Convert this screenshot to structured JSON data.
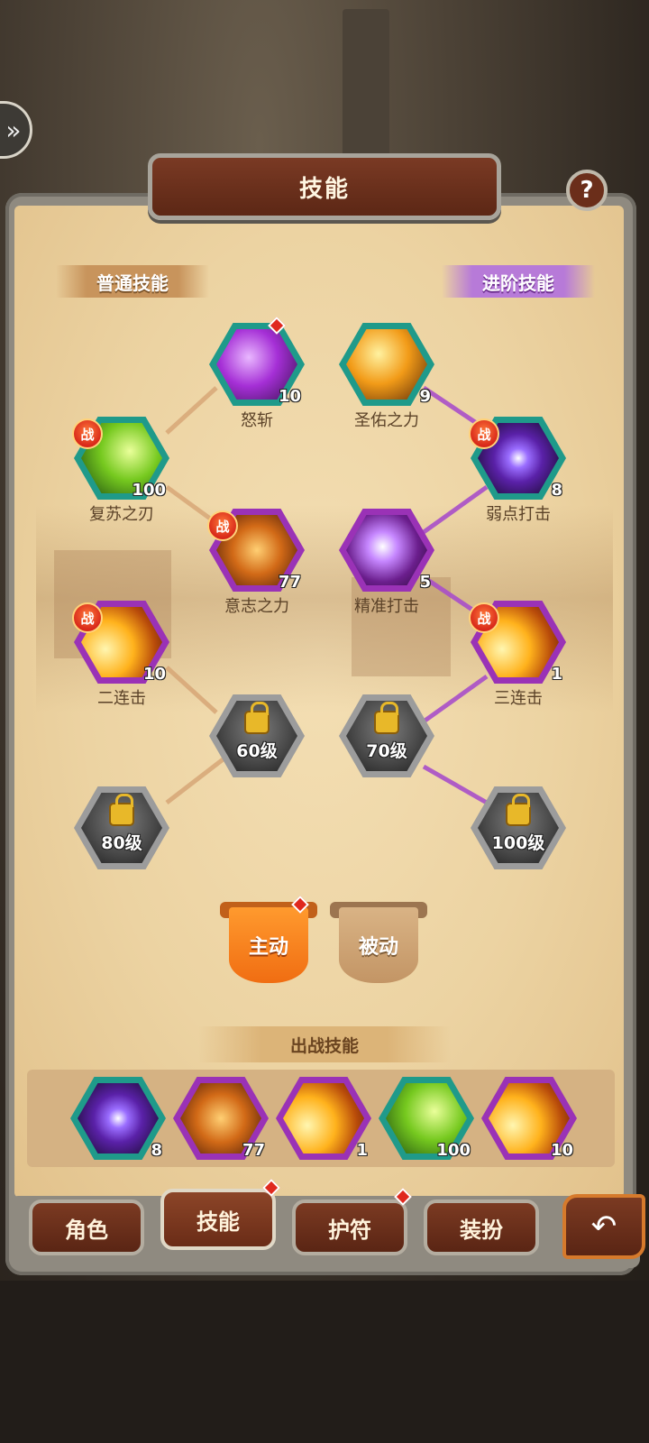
{
  "header": {
    "title": "技能",
    "help_icon": "help-icon",
    "help_label": "?"
  },
  "sections": {
    "normal": "普通技能",
    "advanced": "进阶技能"
  },
  "skill_nodes": [
    {
      "name": "怒斩",
      "level": "10",
      "art": "art-purple",
      "border": "teal"
    },
    {
      "name": "圣佑之力",
      "level": "9",
      "art": "art-gold",
      "border": "teal"
    },
    {
      "name": "复苏之刃",
      "level": "100",
      "art": "art-green",
      "border": "teal",
      "badge": "战"
    },
    {
      "name": "弱点打击",
      "level": "8",
      "art": "art-eye",
      "border": "teal",
      "badge": "战"
    },
    {
      "name": "意志之力",
      "level": "77",
      "art": "art-fist",
      "border": "purple",
      "badge": "战"
    },
    {
      "name": "精准打击",
      "level": "5",
      "art": "art-shadow",
      "border": "purple"
    },
    {
      "name": "二连击",
      "level": "10",
      "art": "art-burst",
      "border": "purple",
      "badge": "战"
    },
    {
      "name": "三连击",
      "level": "1",
      "art": "art-burst",
      "border": "purple",
      "badge": "战"
    }
  ],
  "locked_nodes": [
    {
      "level": "60级"
    },
    {
      "level": "70级"
    },
    {
      "level": "80级"
    },
    {
      "level": "100级"
    }
  ],
  "mode_tabs": {
    "active": "主动",
    "passive": "被动"
  },
  "battle_skills": {
    "title": "出战技能",
    "items": [
      {
        "level": "8",
        "art": "art-eye",
        "border": "teal"
      },
      {
        "level": "77",
        "art": "art-fist",
        "border": "purple"
      },
      {
        "level": "1",
        "art": "art-burst",
        "border": "purple"
      },
      {
        "level": "100",
        "art": "art-green",
        "border": "teal"
      },
      {
        "level": "10",
        "art": "art-burst",
        "border": "purple"
      }
    ]
  },
  "bottom_nav": {
    "role": "角色",
    "skill": "技能",
    "amulet": "护符",
    "outfit": "装扮"
  },
  "colors": {
    "teal_border": "#1f9a8a",
    "purple_border": "#9a32b6",
    "advanced_line": "#a94fc9",
    "normal_line": "#d4a070"
  }
}
